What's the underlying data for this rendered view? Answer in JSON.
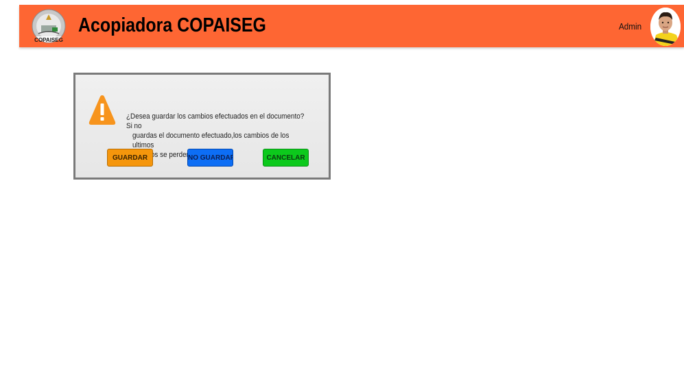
{
  "header": {
    "title": "Acopiadora COPAISEG",
    "logo_text": "COPAISEG",
    "user_label": "Admin",
    "background_color": "#fe6633"
  },
  "dialog": {
    "message_line1": "¿Desea guardar los cambios efectuados en el documento?Si no",
    "message_line2": "guardas el documento efectuado,los cambios de los ultimos",
    "message_line3": "minutos se perderan.",
    "icon": "warning-icon",
    "buttons": {
      "save_label": "GUARDAR",
      "save_color": "#f5960c",
      "dont_save_label": "NO GUARDAR",
      "dont_save_color": "#0d6ef5",
      "cancel_label": "CANCELAR",
      "cancel_color": "#0cc91c"
    }
  }
}
